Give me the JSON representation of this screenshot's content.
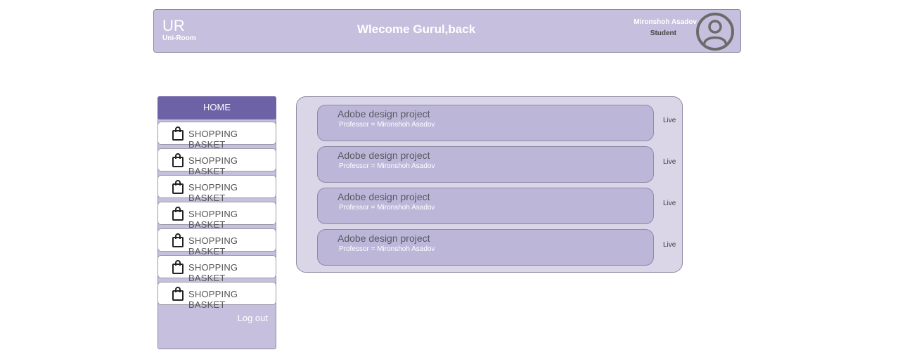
{
  "header": {
    "logo_main": "UR",
    "logo_sub": "Uni-Room",
    "welcome": "Wlecome Gurul,back",
    "user_name": "Mironshoh Asadov",
    "user_role": "Student",
    "avatar_icon": "user-circle-icon"
  },
  "sidebar": {
    "home_label": "HOME",
    "items": [
      {
        "label": "SHOPPING BASKET",
        "icon": "shopping-bag-icon"
      },
      {
        "label": "SHOPPING BASKET",
        "icon": "shopping-bag-icon"
      },
      {
        "label": "SHOPPING BASKET",
        "icon": "shopping-bag-icon"
      },
      {
        "label": "SHOPPING BASKET",
        "icon": "shopping-bag-icon"
      },
      {
        "label": "SHOPPING BASKET",
        "icon": "shopping-bag-icon"
      },
      {
        "label": "SHOPPING BASKET",
        "icon": "shopping-bag-icon"
      },
      {
        "label": "SHOPPING BASKET",
        "icon": "shopping-bag-icon"
      }
    ],
    "logout_label": "Log out"
  },
  "projects": [
    {
      "title": "Adobe design project",
      "subtitle": "Professor = Mironshoh Asadov",
      "status": "Live"
    },
    {
      "title": "Adobe design project",
      "subtitle": "Professor = Mironshoh Asadov",
      "status": "Live"
    },
    {
      "title": "Adobe design project",
      "subtitle": "Professor = Mironshoh Asadov",
      "status": "Live"
    },
    {
      "title": "Adobe design project",
      "subtitle": "Professor = Mironshoh Asadov",
      "status": "Live"
    }
  ],
  "colors": {
    "header_bg": "#c6c0de",
    "home_active": "#6d62a6",
    "panel_bg": "#dad6e8",
    "card_bg": "#bcb7d9"
  }
}
